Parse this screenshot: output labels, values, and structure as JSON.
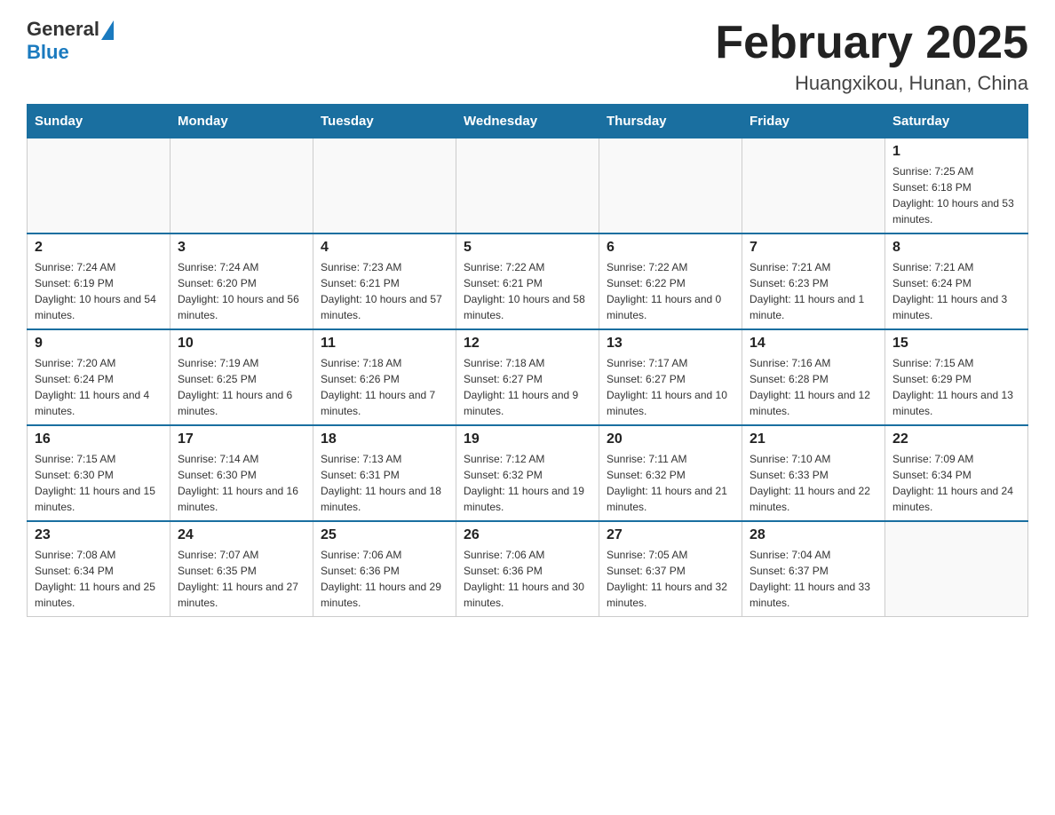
{
  "header": {
    "logo_general": "General",
    "logo_blue": "Blue",
    "title": "February 2025",
    "subtitle": "Huangxikou, Hunan, China"
  },
  "calendar": {
    "days_of_week": [
      "Sunday",
      "Monday",
      "Tuesday",
      "Wednesday",
      "Thursday",
      "Friday",
      "Saturday"
    ],
    "weeks": [
      [
        {
          "day": "",
          "sunrise": "",
          "sunset": "",
          "daylight": ""
        },
        {
          "day": "",
          "sunrise": "",
          "sunset": "",
          "daylight": ""
        },
        {
          "day": "",
          "sunrise": "",
          "sunset": "",
          "daylight": ""
        },
        {
          "day": "",
          "sunrise": "",
          "sunset": "",
          "daylight": ""
        },
        {
          "day": "",
          "sunrise": "",
          "sunset": "",
          "daylight": ""
        },
        {
          "day": "",
          "sunrise": "",
          "sunset": "",
          "daylight": ""
        },
        {
          "day": "1",
          "sunrise": "Sunrise: 7:25 AM",
          "sunset": "Sunset: 6:18 PM",
          "daylight": "Daylight: 10 hours and 53 minutes."
        }
      ],
      [
        {
          "day": "2",
          "sunrise": "Sunrise: 7:24 AM",
          "sunset": "Sunset: 6:19 PM",
          "daylight": "Daylight: 10 hours and 54 minutes."
        },
        {
          "day": "3",
          "sunrise": "Sunrise: 7:24 AM",
          "sunset": "Sunset: 6:20 PM",
          "daylight": "Daylight: 10 hours and 56 minutes."
        },
        {
          "day": "4",
          "sunrise": "Sunrise: 7:23 AM",
          "sunset": "Sunset: 6:21 PM",
          "daylight": "Daylight: 10 hours and 57 minutes."
        },
        {
          "day": "5",
          "sunrise": "Sunrise: 7:22 AM",
          "sunset": "Sunset: 6:21 PM",
          "daylight": "Daylight: 10 hours and 58 minutes."
        },
        {
          "day": "6",
          "sunrise": "Sunrise: 7:22 AM",
          "sunset": "Sunset: 6:22 PM",
          "daylight": "Daylight: 11 hours and 0 minutes."
        },
        {
          "day": "7",
          "sunrise": "Sunrise: 7:21 AM",
          "sunset": "Sunset: 6:23 PM",
          "daylight": "Daylight: 11 hours and 1 minute."
        },
        {
          "day": "8",
          "sunrise": "Sunrise: 7:21 AM",
          "sunset": "Sunset: 6:24 PM",
          "daylight": "Daylight: 11 hours and 3 minutes."
        }
      ],
      [
        {
          "day": "9",
          "sunrise": "Sunrise: 7:20 AM",
          "sunset": "Sunset: 6:24 PM",
          "daylight": "Daylight: 11 hours and 4 minutes."
        },
        {
          "day": "10",
          "sunrise": "Sunrise: 7:19 AM",
          "sunset": "Sunset: 6:25 PM",
          "daylight": "Daylight: 11 hours and 6 minutes."
        },
        {
          "day": "11",
          "sunrise": "Sunrise: 7:18 AM",
          "sunset": "Sunset: 6:26 PM",
          "daylight": "Daylight: 11 hours and 7 minutes."
        },
        {
          "day": "12",
          "sunrise": "Sunrise: 7:18 AM",
          "sunset": "Sunset: 6:27 PM",
          "daylight": "Daylight: 11 hours and 9 minutes."
        },
        {
          "day": "13",
          "sunrise": "Sunrise: 7:17 AM",
          "sunset": "Sunset: 6:27 PM",
          "daylight": "Daylight: 11 hours and 10 minutes."
        },
        {
          "day": "14",
          "sunrise": "Sunrise: 7:16 AM",
          "sunset": "Sunset: 6:28 PM",
          "daylight": "Daylight: 11 hours and 12 minutes."
        },
        {
          "day": "15",
          "sunrise": "Sunrise: 7:15 AM",
          "sunset": "Sunset: 6:29 PM",
          "daylight": "Daylight: 11 hours and 13 minutes."
        }
      ],
      [
        {
          "day": "16",
          "sunrise": "Sunrise: 7:15 AM",
          "sunset": "Sunset: 6:30 PM",
          "daylight": "Daylight: 11 hours and 15 minutes."
        },
        {
          "day": "17",
          "sunrise": "Sunrise: 7:14 AM",
          "sunset": "Sunset: 6:30 PM",
          "daylight": "Daylight: 11 hours and 16 minutes."
        },
        {
          "day": "18",
          "sunrise": "Sunrise: 7:13 AM",
          "sunset": "Sunset: 6:31 PM",
          "daylight": "Daylight: 11 hours and 18 minutes."
        },
        {
          "day": "19",
          "sunrise": "Sunrise: 7:12 AM",
          "sunset": "Sunset: 6:32 PM",
          "daylight": "Daylight: 11 hours and 19 minutes."
        },
        {
          "day": "20",
          "sunrise": "Sunrise: 7:11 AM",
          "sunset": "Sunset: 6:32 PM",
          "daylight": "Daylight: 11 hours and 21 minutes."
        },
        {
          "day": "21",
          "sunrise": "Sunrise: 7:10 AM",
          "sunset": "Sunset: 6:33 PM",
          "daylight": "Daylight: 11 hours and 22 minutes."
        },
        {
          "day": "22",
          "sunrise": "Sunrise: 7:09 AM",
          "sunset": "Sunset: 6:34 PM",
          "daylight": "Daylight: 11 hours and 24 minutes."
        }
      ],
      [
        {
          "day": "23",
          "sunrise": "Sunrise: 7:08 AM",
          "sunset": "Sunset: 6:34 PM",
          "daylight": "Daylight: 11 hours and 25 minutes."
        },
        {
          "day": "24",
          "sunrise": "Sunrise: 7:07 AM",
          "sunset": "Sunset: 6:35 PM",
          "daylight": "Daylight: 11 hours and 27 minutes."
        },
        {
          "day": "25",
          "sunrise": "Sunrise: 7:06 AM",
          "sunset": "Sunset: 6:36 PM",
          "daylight": "Daylight: 11 hours and 29 minutes."
        },
        {
          "day": "26",
          "sunrise": "Sunrise: 7:06 AM",
          "sunset": "Sunset: 6:36 PM",
          "daylight": "Daylight: 11 hours and 30 minutes."
        },
        {
          "day": "27",
          "sunrise": "Sunrise: 7:05 AM",
          "sunset": "Sunset: 6:37 PM",
          "daylight": "Daylight: 11 hours and 32 minutes."
        },
        {
          "day": "28",
          "sunrise": "Sunrise: 7:04 AM",
          "sunset": "Sunset: 6:37 PM",
          "daylight": "Daylight: 11 hours and 33 minutes."
        },
        {
          "day": "",
          "sunrise": "",
          "sunset": "",
          "daylight": ""
        }
      ]
    ]
  }
}
